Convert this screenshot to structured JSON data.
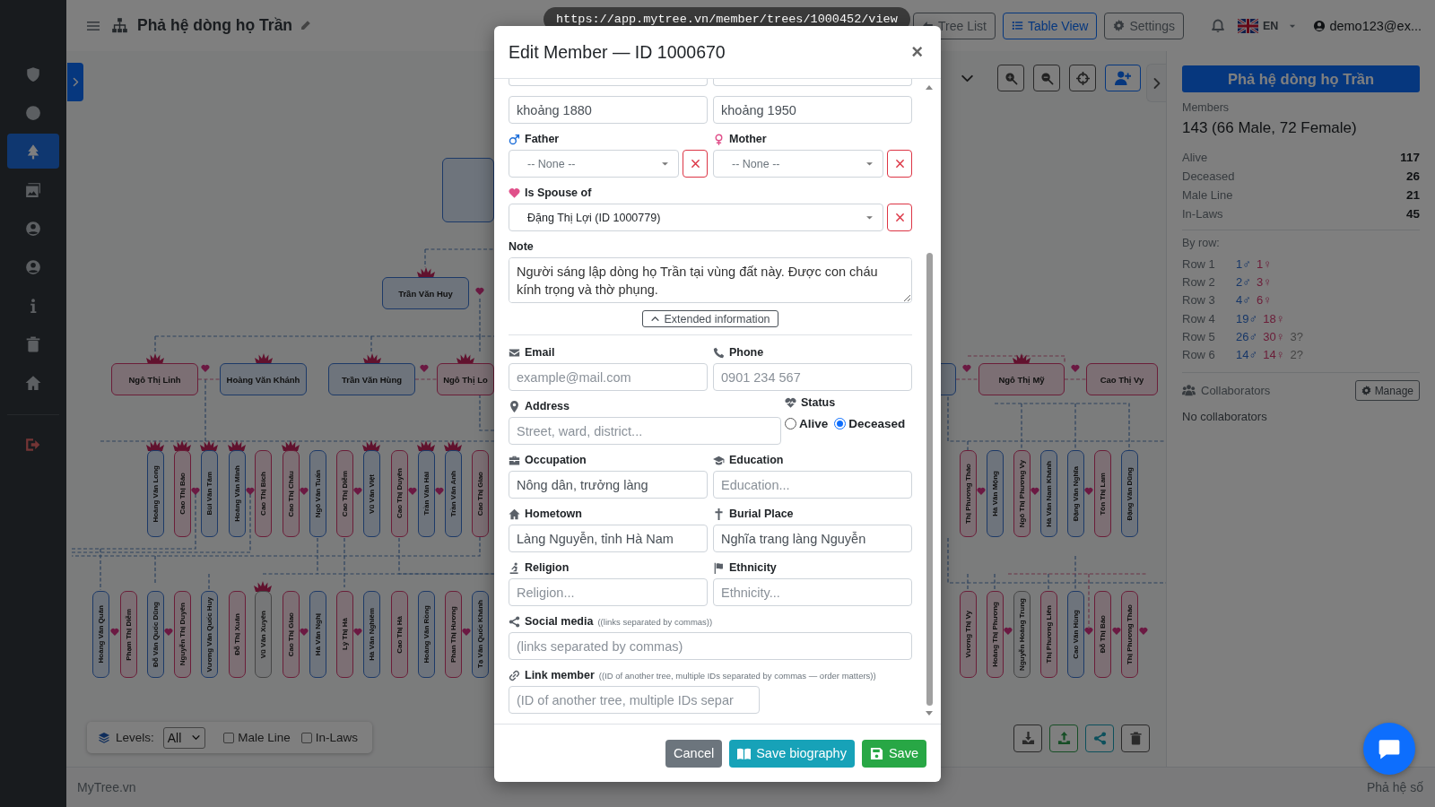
{
  "sidebar": {
    "items": [
      {
        "kind": "shield",
        "selected": false
      },
      {
        "kind": "circle",
        "selected": false
      },
      {
        "kind": "tree",
        "selected": true
      },
      {
        "kind": "images",
        "selected": false
      },
      {
        "kind": "user",
        "selected": false
      },
      {
        "kind": "user",
        "selected": false
      },
      {
        "kind": "info",
        "selected": false
      },
      {
        "kind": "trash",
        "selected": false
      },
      {
        "kind": "home",
        "selected": false
      },
      {
        "kind": "logout",
        "selected": false
      }
    ]
  },
  "topbar": {
    "title": "Phả hệ dòng họ Trần",
    "buttons": [
      {
        "kind": "tree-list",
        "label": "Tree List",
        "selected": false
      },
      {
        "kind": "table-view",
        "label": "Table View",
        "selected": true
      },
      {
        "kind": "settings",
        "label": "Settings",
        "selected": false
      }
    ],
    "language": "EN",
    "user": "demo123@ex..."
  },
  "url_tooltip": "https://app.mytree.vn/member/trees/1000452/view",
  "tree": {
    "groups": [
      {
        "kind": "wide",
        "nodes": [
          {
            "kind": "male",
            "lotus": false
          },
          {
            "name": "Trần Văn Huy",
            "kind": "male",
            "lotus": true
          },
          {
            "name": "Ngô Thị Linh",
            "kind": "female",
            "lotus": true
          },
          {
            "name": "Hoàng Văn Khánh",
            "kind": "male",
            "lotus": true
          },
          {
            "name": "Trần Văn Hùng",
            "kind": "male",
            "lotus": true
          },
          {
            "name": "Ngô Thị Lo",
            "kind": "female",
            "lotus": true
          },
          {
            "kind": "male",
            "lotus": false
          },
          {
            "name": "Ngô Thị Mỹ",
            "kind": "female",
            "lotus": true
          },
          {
            "name": "Cao Thị Vy",
            "kind": "female",
            "lotus": false
          }
        ]
      },
      {
        "kind": "tall",
        "nodes": [
          {
            "name": "Hoàng Văn Long",
            "kind": "male",
            "lotus": true
          },
          {
            "name": "Cao Thị Bảo",
            "kind": "female",
            "lotus": true
          },
          {
            "name": "Bùi Văn Tâm",
            "kind": "male",
            "lotus": true
          },
          {
            "name": "Hoàng Văn Minh",
            "kind": "male",
            "lotus": true
          },
          {
            "name": "Cao Thị Bích",
            "kind": "female",
            "lotus": false
          },
          {
            "name": "Cao Thị Châu",
            "kind": "female",
            "lotus": true
          },
          {
            "name": "Ngô Văn Tuấn",
            "kind": "male",
            "lotus": false
          },
          {
            "name": "Cao Thị Diễm",
            "kind": "female",
            "lotus": false
          },
          {
            "name": "Vũ Văn Việt",
            "kind": "male",
            "lotus": true
          },
          {
            "name": "Cao Thị Duyên",
            "kind": "female",
            "lotus": false
          },
          {
            "name": "Trần Văn Hải",
            "kind": "male",
            "lotus": true
          },
          {
            "name": "Trần Văn Anh",
            "kind": "male",
            "lotus": true
          },
          {
            "name": "Cao Thị Giao",
            "kind": "female",
            "lotus": false
          },
          {
            "name": "Thị Phương Thảo",
            "kind": "female",
            "lotus": false
          },
          {
            "name": "Hà Văn Mộng",
            "kind": "male",
            "lotus": false
          },
          {
            "name": "Ngô Thị Phương Vy",
            "kind": "female",
            "lotus": false
          },
          {
            "name": "Hà Văn Nam Khánh",
            "kind": "male",
            "lotus": false
          },
          {
            "name": "Đặng Văn Nghĩa",
            "kind": "male",
            "lotus": false
          },
          {
            "name": "Tôn Thị Lam",
            "kind": "female",
            "lotus": false
          },
          {
            "name": "Đặng Văn Dũng",
            "kind": "male",
            "lotus": false
          }
        ]
      },
      {
        "kind": "tall",
        "nodes": [
          {
            "name": "Hoàng Văn Quân",
            "kind": "male",
            "lotus": false
          },
          {
            "name": "Phạm Thị Diễm",
            "kind": "female",
            "lotus": false
          },
          {
            "name": "Đỗ Văn Quốc Dũng",
            "kind": "male",
            "lotus": false
          },
          {
            "name": "Nguyễn Thị Duyên",
            "kind": "female",
            "lotus": false
          },
          {
            "name": "Vương Văn Quốc Huy",
            "kind": "male",
            "lotus": false
          },
          {
            "name": "Đỗ Thị Xuân",
            "kind": "female",
            "lotus": false
          },
          {
            "name": "Vũ Văn Xuyên",
            "kind": "unknown",
            "lotus": true
          },
          {
            "name": "Cao Thị Giao",
            "kind": "female",
            "lotus": false
          },
          {
            "name": "Hà Văn Nghị",
            "kind": "male",
            "lotus": false
          },
          {
            "name": "Lý Thị Hà",
            "kind": "female",
            "lotus": false
          },
          {
            "name": "Hà Văn Nghiêm",
            "kind": "male",
            "lotus": false
          },
          {
            "name": "Cao Thị Hà",
            "kind": "female",
            "lotus": false
          },
          {
            "name": "Hoàng Văn Rồng",
            "kind": "male",
            "lotus": false
          },
          {
            "name": "Phan Thị Hương",
            "kind": "female",
            "lotus": false
          },
          {
            "name": "Tạ Văn Quốc Khánh",
            "kind": "male",
            "lotus": false
          },
          {
            "name": "Vương Thị Vy",
            "kind": "female",
            "lotus": false
          },
          {
            "name": "Hoàng Thị Phương",
            "kind": "female",
            "lotus": false
          },
          {
            "name": "Nguyễn Hoàng Trung",
            "kind": "unknown",
            "lotus": false
          },
          {
            "name": "Thị Phương Liên",
            "kind": "female",
            "lotus": false
          },
          {
            "name": "Cao Văn Hùng",
            "kind": "male",
            "lotus": false
          },
          {
            "name": "Đỗ Thị Bảo",
            "kind": "female",
            "lotus": false
          },
          {
            "name": "Thị Phương Thảo",
            "kind": "female",
            "lotus": false
          }
        ]
      }
    ]
  },
  "tree_controls": {
    "levels_label": "Levels:",
    "levels_value": "All",
    "filters": [
      {
        "label": "Male Line",
        "checked": false
      },
      {
        "label": "In-Laws",
        "checked": false
      }
    ]
  },
  "summary": {
    "title": "Phả hệ dòng họ Trần",
    "members_label": "Members",
    "members_total": "143 (66 Male, 72 Female)",
    "stats": [
      {
        "label": "Alive",
        "value": "117"
      },
      {
        "label": "Deceased",
        "value": "26"
      },
      {
        "label": "Male Line",
        "value": "21"
      },
      {
        "label": "In-Laws",
        "value": "45"
      }
    ],
    "by_row_label": "By row:",
    "rows": [
      {
        "label": "Row 1",
        "male": "1♂",
        "female": "1♀"
      },
      {
        "label": "Row 2",
        "male": "2♂",
        "female": "3♀"
      },
      {
        "label": "Row 3",
        "male": "4♂",
        "female": "6♀"
      },
      {
        "label": "Row 4",
        "male": "19♂",
        "female": "18♀"
      },
      {
        "label": "Row 5",
        "male": "26♂",
        "female": "30♀",
        "unknown": "3?"
      },
      {
        "label": "Row 6",
        "male": "14♂",
        "female": "14♀",
        "unknown": "2?"
      }
    ],
    "collaborators_label": "Collaborators",
    "manage": "Manage",
    "collaborators_empty": "No collaborators"
  },
  "footer": {
    "brand": "MyTree.vn",
    "tagline": "Phả hệ số"
  },
  "modal": {
    "title": "Edit Member — ID 1000670",
    "close": "×",
    "approx_dates": [
      {
        "value": "khoảng 1880"
      },
      {
        "value": "khoảng 1950"
      }
    ],
    "parents": [
      {
        "kind": "male",
        "label": "Father",
        "placeholder": "-- None --"
      },
      {
        "kind": "female",
        "label": "Mother",
        "placeholder": "-- None --"
      }
    ],
    "spouse": {
      "label": "Is Spouse of",
      "value": "Đặng Thị Lợi (ID 1000779)"
    },
    "note": {
      "label": "Note",
      "value": "Người sáng lập dòng họ Trần tại vùng đất này. Được con cháu kính trọng và thờ phụng."
    },
    "extended": {
      "label": "Extended information",
      "expanded": true
    },
    "fields": [
      {
        "label": "Email",
        "placeholder": "example@mail.com"
      },
      {
        "label": "Phone",
        "placeholder": "0901 234 567"
      },
      {
        "label": "Address",
        "placeholder": "Street, ward, district..."
      },
      {
        "label": "Occupation",
        "value": "Nông dân, trưởng làng"
      },
      {
        "label": "Education",
        "placeholder": "Education..."
      },
      {
        "label": "Hometown",
        "value": "Làng Nguyễn, tỉnh Hà Nam"
      },
      {
        "label": "Burial Place",
        "value": "Nghĩa trang làng Nguyễn"
      },
      {
        "label": "Religion",
        "placeholder": "Religion..."
      },
      {
        "label": "Ethnicity",
        "placeholder": "Ethnicity..."
      },
      {
        "label": "Social media",
        "hint": "((links separated by commas))",
        "placeholder": "(links separated by commas)"
      },
      {
        "label": "Link member",
        "hint": "((ID of another tree, multiple IDs separated by commas — order matters))",
        "placeholder": "(ID of another tree, multiple IDs separ"
      }
    ],
    "status": {
      "label": "Status",
      "options": [
        {
          "label": "Alive",
          "selected": false
        },
        {
          "label": "Deceased",
          "selected": true
        }
      ]
    },
    "buttons": [
      {
        "kind": "secondary",
        "label": "Cancel"
      },
      {
        "kind": "info",
        "label": "Save biography"
      },
      {
        "kind": "success",
        "label": "Save"
      }
    ]
  }
}
